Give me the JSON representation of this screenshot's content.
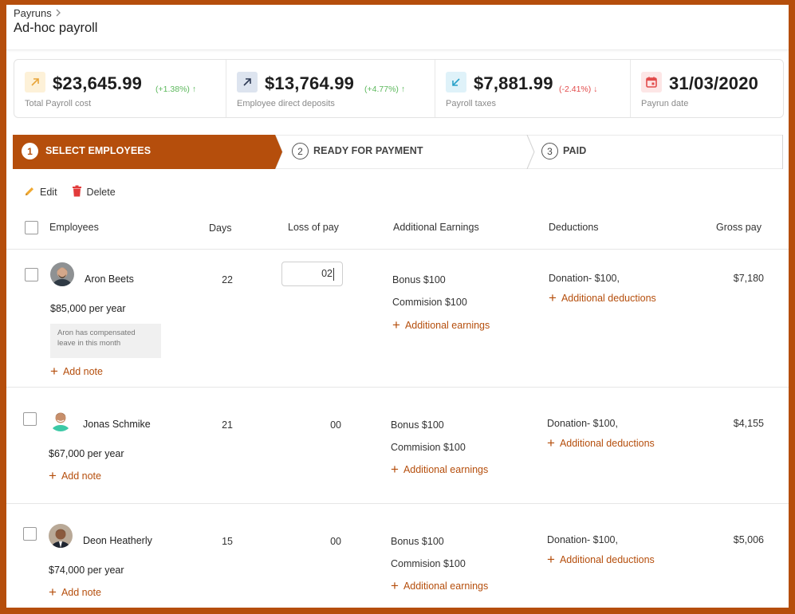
{
  "breadcrumb": {
    "parent": "Payruns"
  },
  "page": {
    "title": "Ad-hoc payroll"
  },
  "stats": [
    {
      "value": "$23,645.99",
      "delta": "(+1.38%)",
      "trend": "up",
      "label": "Total Payroll cost",
      "icon": "arrow-up-right-icon"
    },
    {
      "value": "$13,764.99",
      "delta": "(+4.77%)",
      "trend": "up",
      "label": "Employee direct deposits",
      "icon": "arrow-up-right-icon"
    },
    {
      "value": "$7,881.99",
      "delta": "(-2.41%)",
      "trend": "down",
      "label": "Payroll taxes",
      "icon": "arrow-down-left-icon"
    },
    {
      "value": "31/03/2020",
      "label": "Payrun date",
      "icon": "calendar-icon"
    }
  ],
  "steps": [
    {
      "num": "1",
      "label": "SELECT EMPLOYEES",
      "active": true
    },
    {
      "num": "2",
      "label": "READY FOR PAYMENT",
      "active": false
    },
    {
      "num": "3",
      "label": "PAID",
      "active": false
    }
  ],
  "actions": {
    "edit": "Edit",
    "delete": "Delete"
  },
  "table": {
    "headers": {
      "employees": "Employees",
      "days": "Days",
      "loss_of_pay": "Loss of pay",
      "additional_earnings": "Additional Earnings",
      "deductions": "Deductions",
      "gross_pay": "Gross pay"
    },
    "add_note": "Add note",
    "additional_earnings_link": "Additional earnings",
    "additional_deductions_link": "Additional deductions",
    "rows": [
      {
        "name": "Aron Beets",
        "salary": "$85,000 per year",
        "note": "Aron has compensated leave in this month",
        "days": "22",
        "loss_of_pay": "02",
        "earnings": [
          "Bonus $100",
          "Commision $100"
        ],
        "deduction": "Donation- $100,",
        "gross": "$7,180"
      },
      {
        "name": "Jonas Schmike",
        "salary": "$67,000 per year",
        "days": "21",
        "loss_of_pay": "00",
        "earnings": [
          "Bonus $100",
          "Commision $100"
        ],
        "deduction": "Donation- $100,",
        "gross": "$4,155"
      },
      {
        "name": "Deon Heatherly",
        "salary": "$74,000 per year",
        "days": "15",
        "loss_of_pay": "00",
        "earnings": [
          "Bonus $100",
          "Commision $100"
        ],
        "deduction": "Donation- $100,",
        "gross": "$5,006"
      }
    ]
  },
  "colors": {
    "accent": "#b54e0c",
    "positive": "#5cb85c",
    "negative": "#e24b4b"
  }
}
